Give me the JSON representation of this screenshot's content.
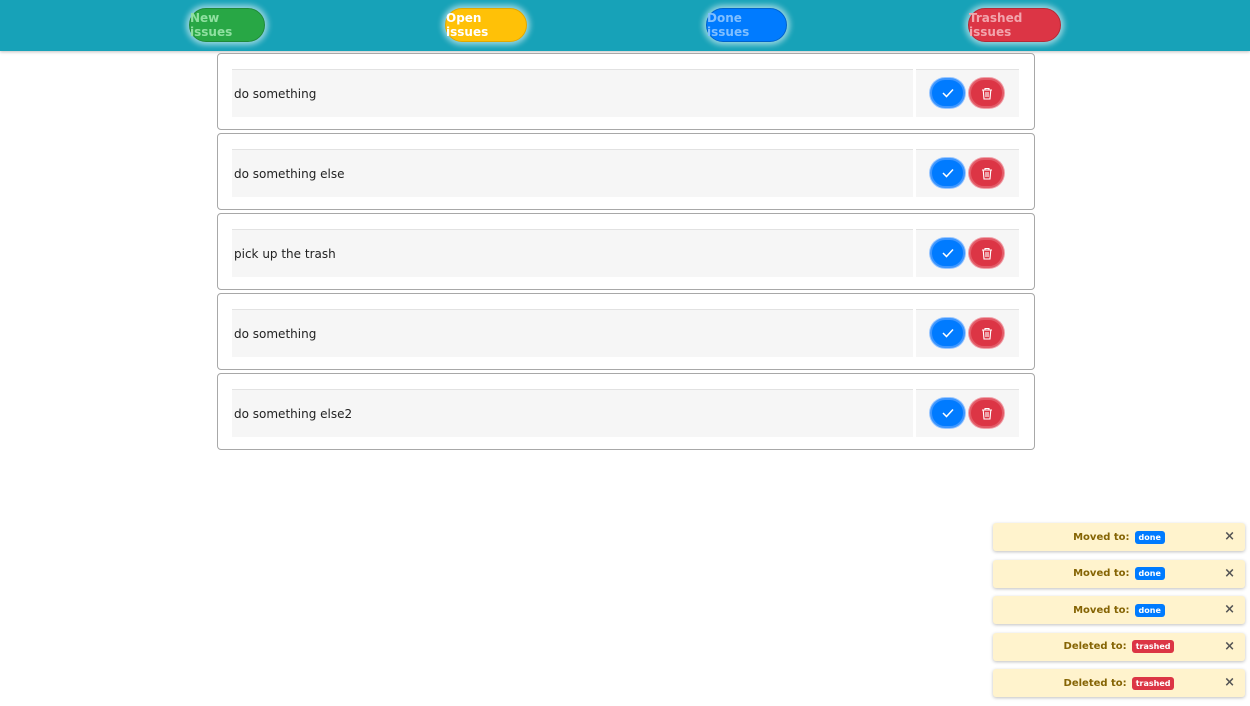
{
  "nav": {
    "new_label": "New issues",
    "open_label": "Open issues",
    "done_label": "Done issues",
    "trashed_label": "Trashed issues"
  },
  "issues": [
    {
      "text": "do something"
    },
    {
      "text": "do something else"
    },
    {
      "text": "pick up the trash"
    },
    {
      "text": "do something"
    },
    {
      "text": "do something else2"
    }
  ],
  "icons": {
    "done": "check-icon",
    "trash": "trash-icon",
    "close": "close-icon"
  },
  "colors": {
    "topbar": "#17a2b8",
    "new": "#28a745",
    "open": "#ffc107",
    "done": "#007bff",
    "trashed": "#dc3545",
    "toast_bg": "#fff3cd",
    "toast_text": "#856404"
  },
  "toasts": [
    {
      "label": "Moved to:",
      "badge": "done",
      "close": "×"
    },
    {
      "label": "Moved to:",
      "badge": "done",
      "close": "×"
    },
    {
      "label": "Moved to:",
      "badge": "done",
      "close": "×"
    },
    {
      "label": "Deleted to:",
      "badge": "trashed",
      "close": "×"
    },
    {
      "label": "Deleted to:",
      "badge": "trashed",
      "close": "×"
    }
  ]
}
